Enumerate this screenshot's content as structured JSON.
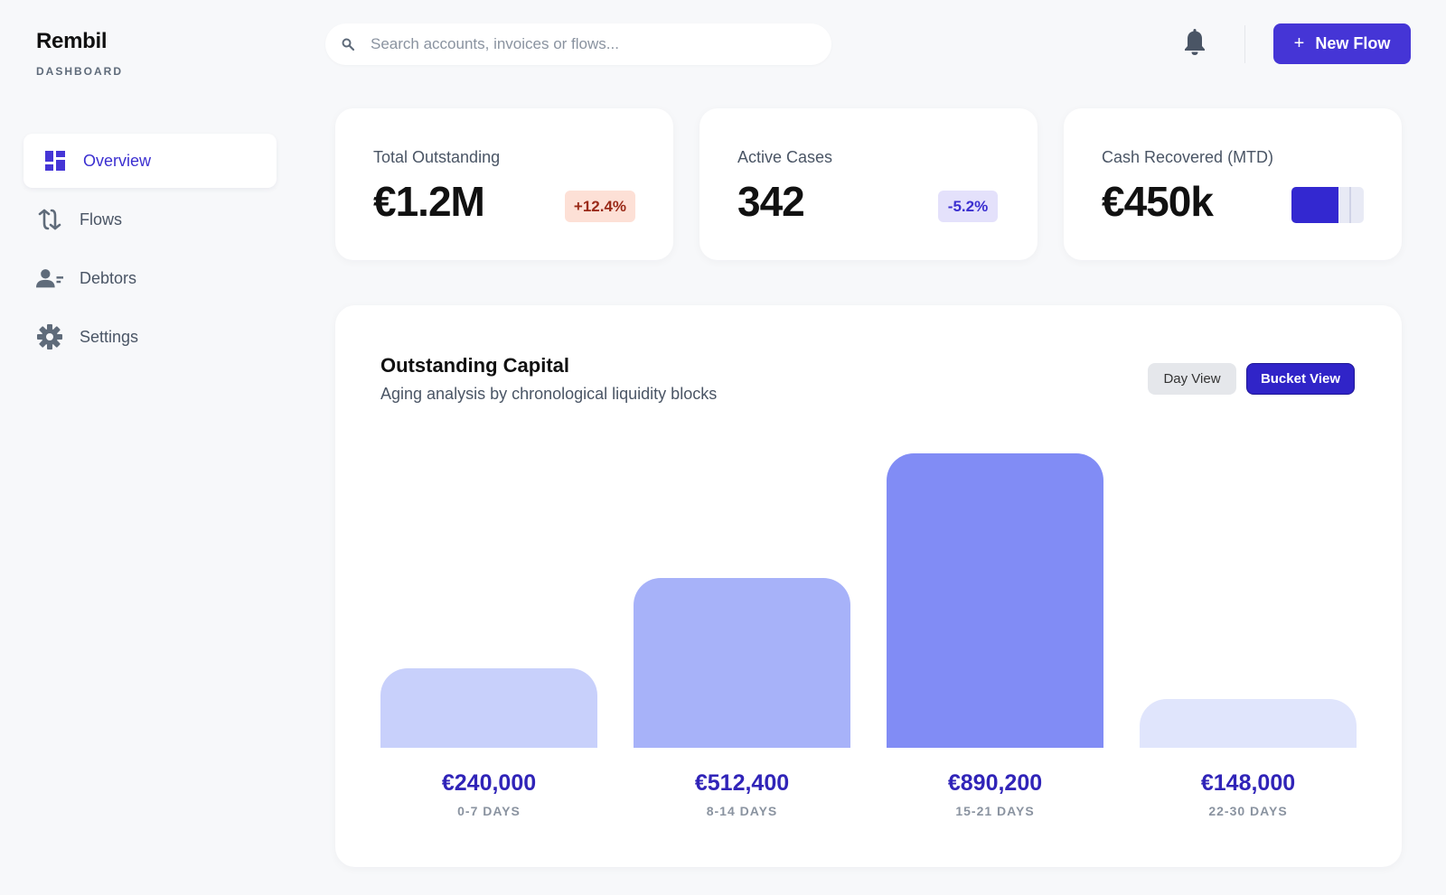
{
  "brand": {
    "name": "Rembil",
    "subtitle": "DASHBOARD"
  },
  "sidebar": {
    "items": [
      {
        "label": "Overview",
        "icon": "dashboard-icon",
        "active": true
      },
      {
        "label": "Flows",
        "icon": "flows-icon",
        "active": false
      },
      {
        "label": "Debtors",
        "icon": "debtors-icon",
        "active": false
      },
      {
        "label": "Settings",
        "icon": "gear-icon",
        "active": false
      }
    ]
  },
  "header": {
    "search_placeholder": "Search accounts, invoices or flows...",
    "notification_icon": "bell-icon",
    "new_flow_plus": "+",
    "new_flow_label": "New Flow"
  },
  "kpis": [
    {
      "label": "Total Outstanding",
      "value": "€1.2M",
      "badge": "+12.4%"
    },
    {
      "label": "Active Cases",
      "value": "342",
      "badge": "-5.2%"
    },
    {
      "label": "Cash Recovered (MTD)",
      "value": "€450k",
      "progress": 0.65
    }
  ],
  "chart_section": {
    "title": "Outstanding Capital",
    "subtitle": "Aging analysis by chronological liquidity blocks",
    "views": {
      "day": "Day View",
      "bucket": "Bucket View"
    },
    "active_view": "bucket"
  },
  "chart_data": {
    "type": "bar",
    "categories": [
      "0-7 DAYS",
      "8-14 DAYS",
      "15-21 DAYS",
      "22-30 DAYS"
    ],
    "values": [
      240000,
      512400,
      890200,
      148000
    ],
    "value_labels": [
      "€240,000",
      "€512,400",
      "€890,200",
      "€148,000"
    ],
    "colors": [
      "#c8d0fb",
      "#a7b2f9",
      "#818cf5",
      "#e0e5fc"
    ],
    "title": "",
    "xlabel": "",
    "ylabel": "",
    "ylim": [
      0,
      900000
    ],
    "grid": false
  },
  "colors": {
    "accent": "#4535d6",
    "accent_dark": "#3024c8",
    "text_muted": "#4a5565",
    "badge_up_bg": "#fde0d6",
    "badge_down_bg": "#e4e1fb"
  }
}
